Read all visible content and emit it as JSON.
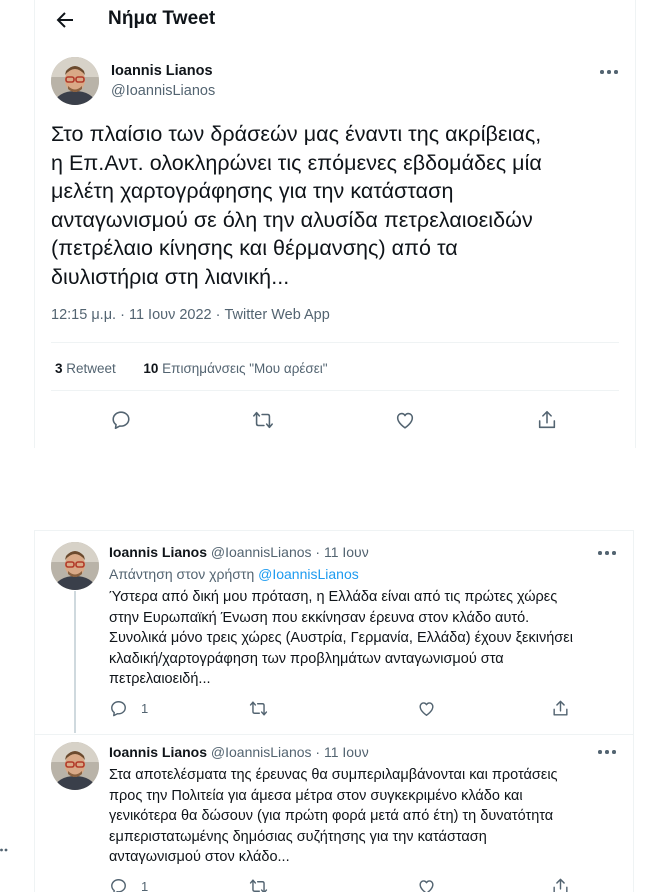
{
  "header": {
    "title": "Νήμα Tweet"
  },
  "tweet": {
    "author_name": "Ioannis Lianos",
    "author_handle": "@IoannisLianos",
    "text": "Στο πλαίσιο των δράσεών μας έναντι της ακρίβειας,\nη Επ.Αντ. ολοκληρώνει τις επόμενες εβδομάδες μία\nμελέτη χαρτογράφησης για την κατάσταση\nανταγωνισμού σε όλη την αλυσίδα πετρελαιοειδών\n(πετρέλαιο κίνησης και θέρμανσης) από τα\nδιυλιστήρια στη λιανική...",
    "meta": "12:15 μ.μ. · 11 Ιουν 2022 · Twitter Web App",
    "retweets_count": "3",
    "retweets_label": "Retweet",
    "likes_count": "10",
    "likes_label": "Επισημάνσεις \"Μου αρέσει\""
  },
  "replies": [
    {
      "author_name": "Ioannis Lianos",
      "author_handle": "@IoannisLianos · 11 Ιουν",
      "reply_to_prefix": "Απάντηση στον χρήστη",
      "reply_to_handle": "@IoannisLianos",
      "text": "Ύστερα από δική μου πρόταση, η Ελλάδα είναι από τις πρώτες χώρες\nστην Ευρωπαϊκή Ένωση που εκκίνησαν έρευνα στον κλάδο αυτό.\nΣυνολικά μόνο τρεις χώρες (Αυστρία, Γερμανία, Ελλάδα) έχουν ξεκινήσει\nκλαδική/χαρτογράφηση των προβλημάτων ανταγωνισμού στα\nπετρελαιοειδή...",
      "reply_count": "1"
    },
    {
      "author_name": "Ioannis Lianos",
      "author_handle": "@IoannisLianos · 11 Ιουν",
      "text": "Στα αποτελέσματα της έρευνας θα συμπεριλαμβάνονται και προτάσεις\nπρος την Πολιτεία για άμεσα μέτρα στον συγκεκριμένο κλάδο και\nγενικότερα θα δώσουν (για πρώτη φορά μετά από έτη) τη δυνατότητα\nεμπεριστατωμένης δημόσιας συζήτησης για την κατάσταση\nανταγωνισμού στον κλάδο...",
      "reply_count": "1"
    }
  ],
  "icons": {
    "back": "arrow-left-icon",
    "more": "more-horizontal-icon",
    "reply": "reply-icon",
    "retweet": "retweet-icon",
    "like": "heart-icon",
    "share": "share-icon"
  },
  "colors": {
    "text": "#0f1419",
    "secondary": "#536471",
    "link": "#1d9bf0",
    "divider": "#eff3f4"
  }
}
